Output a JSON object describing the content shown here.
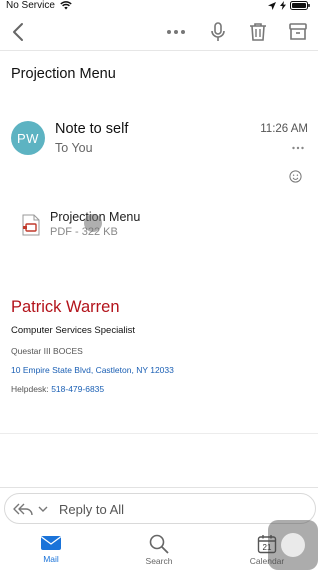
{
  "status_bar": {
    "carrier": "No Service"
  },
  "message": {
    "subject": "Projection Menu",
    "avatar_initials": "PW",
    "sender": "Note to self",
    "recipient": "To You",
    "time": "11:26 AM"
  },
  "attachment": {
    "name": "Projection Menu",
    "meta": "PDF - 322 KB"
  },
  "signature": {
    "name": "Patrick Warren",
    "title": "Computer Services Specialist",
    "organization": "Questar III BOCES",
    "address": "10 Empire State Blvd, Castleton, NY 12033",
    "helpdesk_label": "Helpdesk:",
    "helpdesk_phone": "518-479-6835"
  },
  "reply": {
    "label": "Reply to All"
  },
  "tabs": [
    {
      "label": "Mail",
      "active": true
    },
    {
      "label": "Search",
      "active": false
    },
    {
      "label": "Calendar",
      "active": false,
      "day": "21"
    }
  ],
  "colors": {
    "accent": "#1a73d9",
    "signature_name": "#b3131b",
    "avatar": "#5db3c2",
    "link": "#1a5fb4"
  }
}
